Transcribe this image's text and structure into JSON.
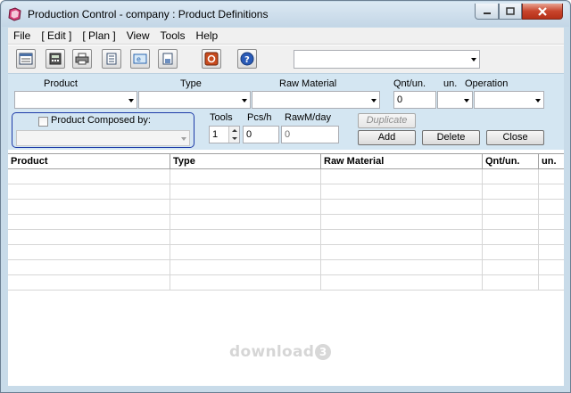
{
  "window": {
    "title": "Production Control - company : Product Definitions"
  },
  "menu": {
    "items": [
      "File",
      "[ Edit ]",
      "[ Plan ]",
      "View",
      "Tools",
      "Help"
    ]
  },
  "toolbar": {
    "icons": [
      "grid-view-icon",
      "calculator-icon",
      "printer-icon",
      "document-icon",
      "web-icon",
      "save-icon",
      "stop-icon",
      "help-icon"
    ],
    "combo_value": ""
  },
  "form": {
    "labels": {
      "product": "Product",
      "type": "Type",
      "raw_material": "Raw Material",
      "qnt_un": "Qnt/un.",
      "un": "un.",
      "operation": "Operation",
      "composed_by": "Product Composed by:",
      "tools": "Tools",
      "pcs_h": "Pcs/h",
      "rawm_day": "RawM/day"
    },
    "values": {
      "product": "",
      "type": "",
      "raw_material": "",
      "qnt_un": "0",
      "un": "",
      "operation": "",
      "composed_by": "",
      "tools": "1",
      "pcs_h": "0",
      "rawm_day": "0"
    },
    "buttons": {
      "duplicate": "Duplicate",
      "add": "Add",
      "delete": "Delete",
      "close": "Close"
    }
  },
  "grid": {
    "columns": [
      "Product",
      "Type",
      "Raw Material",
      "Qnt/un.",
      "un."
    ],
    "rows": 8
  },
  "watermark": {
    "text": "download",
    "badge": "3"
  }
}
